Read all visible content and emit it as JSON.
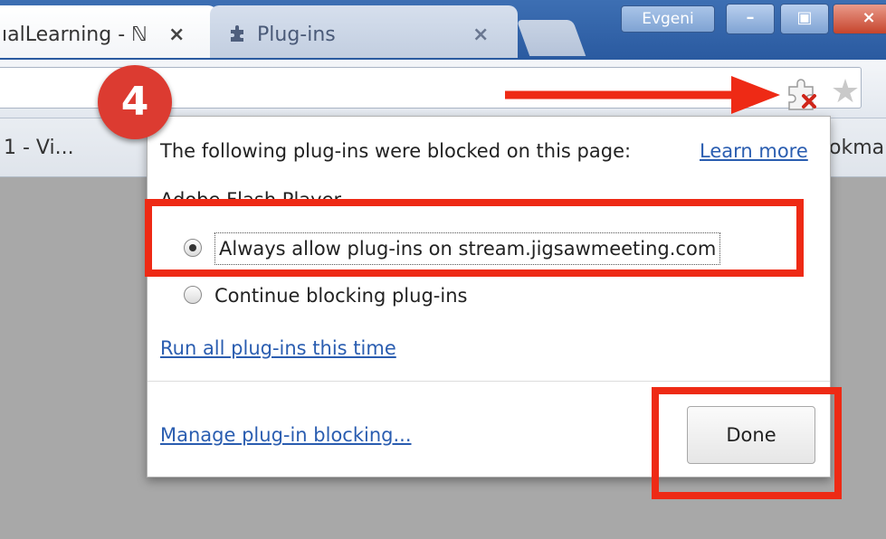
{
  "browser": {
    "tabs": [
      {
        "title": "ıalLearning - ℕ",
        "close": "×",
        "active": true
      },
      {
        "title": "Plug-ins",
        "close": "×",
        "active": false,
        "icon": "puzzle-icon"
      }
    ],
    "user": "Evgeni",
    "window_controls": {
      "minimize": "–",
      "maximize": "▣",
      "close": "×"
    },
    "toolbar": {
      "blocked_plugin_icon": "puzzle-blocked-icon",
      "bookmark_star_icon": "star-icon",
      "star_glyph": "★"
    },
    "bookmarks": {
      "left_item": "1 - Vi...",
      "right_item": "okma"
    }
  },
  "popup": {
    "heading": "The following plug-ins were blocked on this page:",
    "learn_more": "Learn more",
    "plugin_name": "Adobe Flash Player",
    "options": [
      {
        "label": "Always allow plug-ins on stream.jigsawmeeting.com",
        "selected": true
      },
      {
        "label": "Continue blocking plug-ins",
        "selected": false
      }
    ],
    "run_all_link": "Run all plug-ins this time",
    "manage_link": "Manage plug-in blocking...",
    "done_button": "Done"
  },
  "annotations": {
    "step_number": "4",
    "highlight_color": "#ee2a15",
    "badge_color": "#dc3b31"
  }
}
